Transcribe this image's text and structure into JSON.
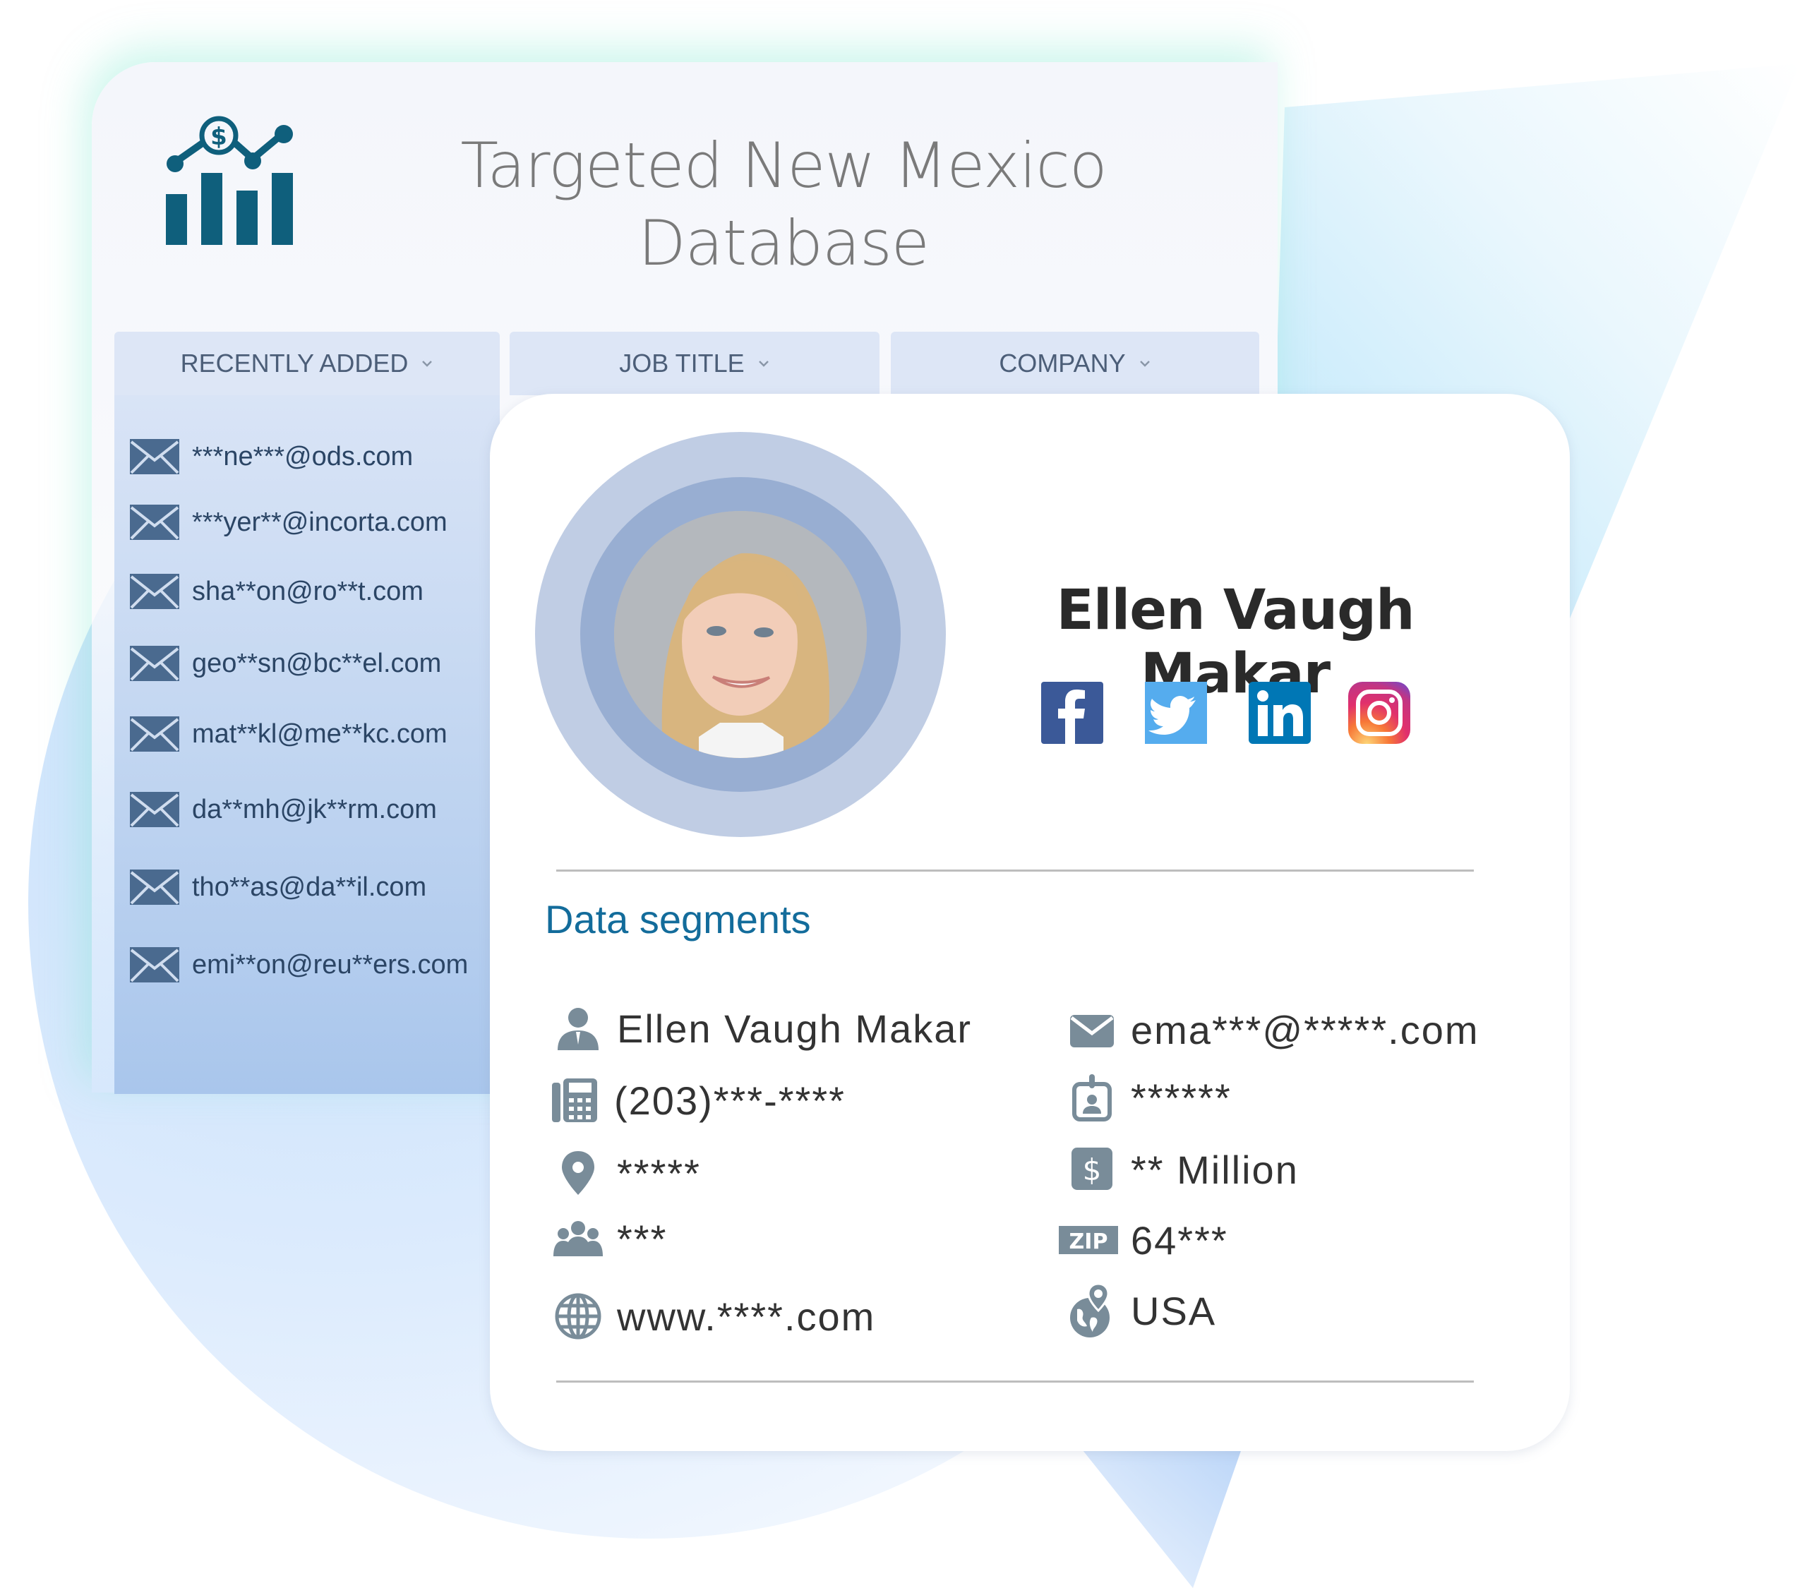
{
  "header": {
    "title_line1": "Targeted New Mexico",
    "title_line2": "Database",
    "logo_icon": "chart-dollar-icon"
  },
  "tabs": [
    {
      "label": "RECENTLY ADDED",
      "icon": "chevron-down-icon"
    },
    {
      "label": "JOB TITLE",
      "icon": "chevron-down-icon"
    },
    {
      "label": "COMPANY",
      "icon": "chevron-down-icon"
    }
  ],
  "recent_emails": [
    "***ne***@ods.com",
    "***yer**@incorta.com",
    "sha**on@ro**t.com",
    "geo**sn@bc**el.com",
    "mat**kl@me**kc.com",
    "da**mh@jk**rm.com",
    "tho**as@da**il.com",
    "emi**on@reu**ers.com"
  ],
  "profile": {
    "name": "Ellen Vaugh Makar",
    "avatar": "profile-photo",
    "social": [
      {
        "name": "facebook",
        "color": "#3b5998"
      },
      {
        "name": "twitter",
        "color": "#55acee"
      },
      {
        "name": "linkedin",
        "color": "#0077b5"
      },
      {
        "name": "instagram",
        "color": "#c13584"
      }
    ]
  },
  "segments": {
    "title": "Data segments",
    "left": [
      {
        "icon": "person-icon",
        "value": "Ellen Vaugh Makar"
      },
      {
        "icon": "phone-icon",
        "value": "(203)***-****"
      },
      {
        "icon": "location-pin-icon",
        "value": "*****"
      },
      {
        "icon": "group-icon",
        "value": "***"
      },
      {
        "icon": "globe-icon",
        "value": "www.****.com"
      }
    ],
    "right": [
      {
        "icon": "envelope-icon",
        "value": "ema***@*****.com"
      },
      {
        "icon": "id-badge-icon",
        "value": "******"
      },
      {
        "icon": "dollar-icon",
        "value": "** Million"
      },
      {
        "icon": "zip-icon",
        "value": "64***",
        "icon_text": "ZIP"
      },
      {
        "icon": "globe-pin-icon",
        "value": "USA"
      }
    ]
  },
  "colors": {
    "accent": "#136c9b",
    "logo": "#0f5f7c",
    "icon_gray": "#798c99",
    "email_icon": "#4a6a8f"
  }
}
